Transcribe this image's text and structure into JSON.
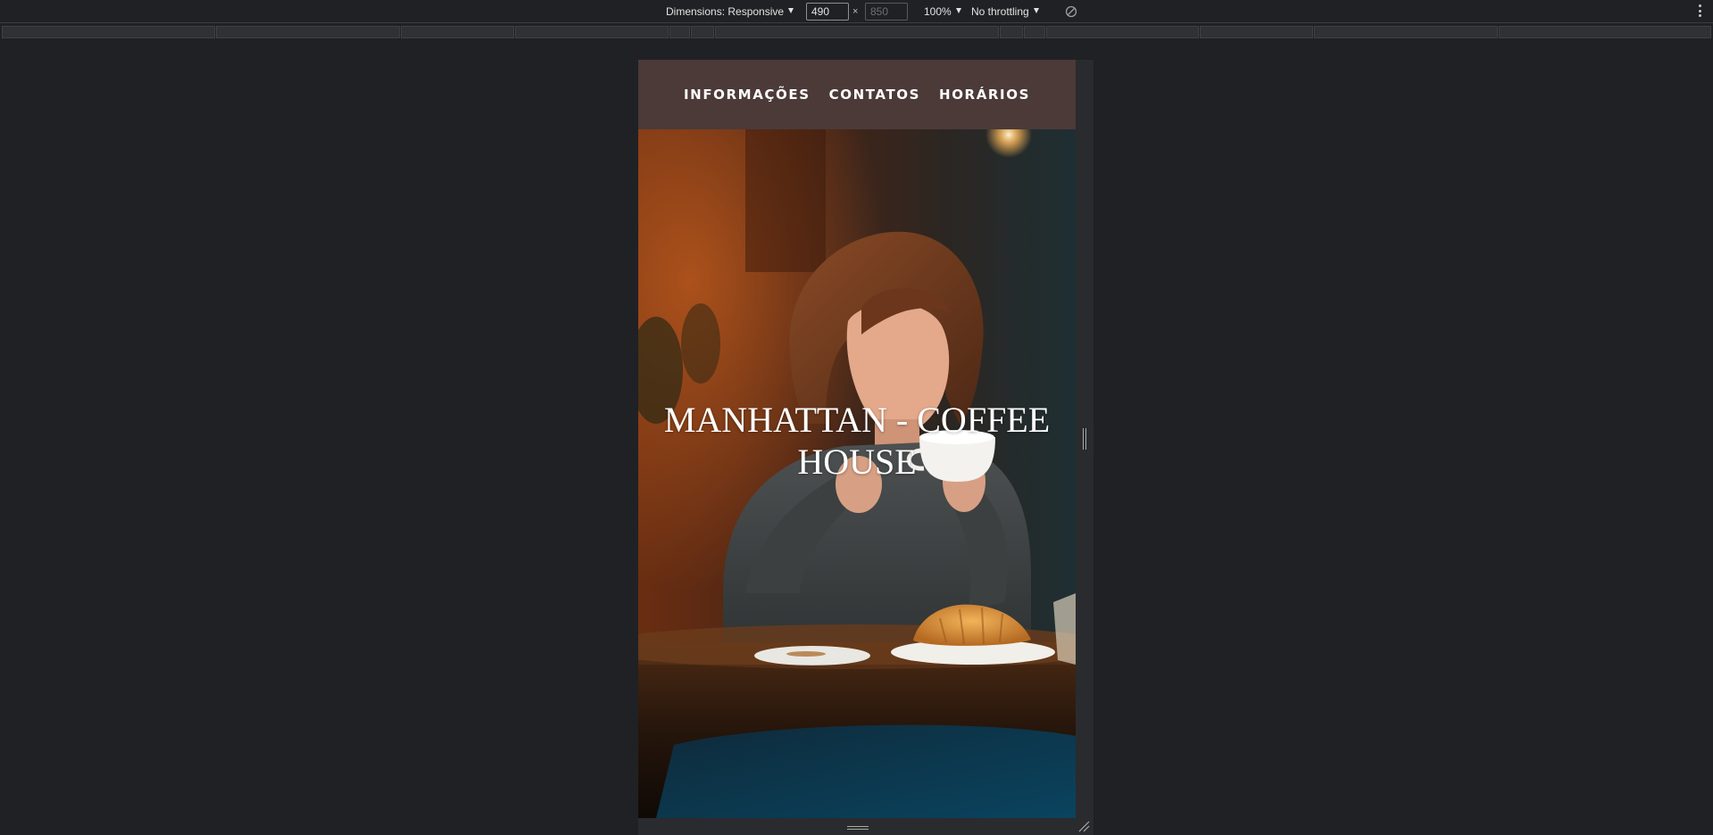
{
  "devtools": {
    "dimensions_label": "Dimensions: Responsive",
    "width_value": "490",
    "height_placeholder": "850",
    "times_symbol": "×",
    "zoom_label": "100%",
    "throttling_label": "No throttling",
    "rotate_icon": "rotate-icon",
    "more_icon": "more-vertical-icon"
  },
  "site": {
    "nav": [
      {
        "label": "INFORMAÇÕES"
      },
      {
        "label": "CONTATOS"
      },
      {
        "label": "HORÁRIOS"
      }
    ],
    "hero": {
      "title_line1": "MANHATTAN - COFFEE",
      "title_line2": "HOUSE"
    },
    "colors": {
      "nav_background": "#4b3a38",
      "page_background": "#202124"
    }
  }
}
